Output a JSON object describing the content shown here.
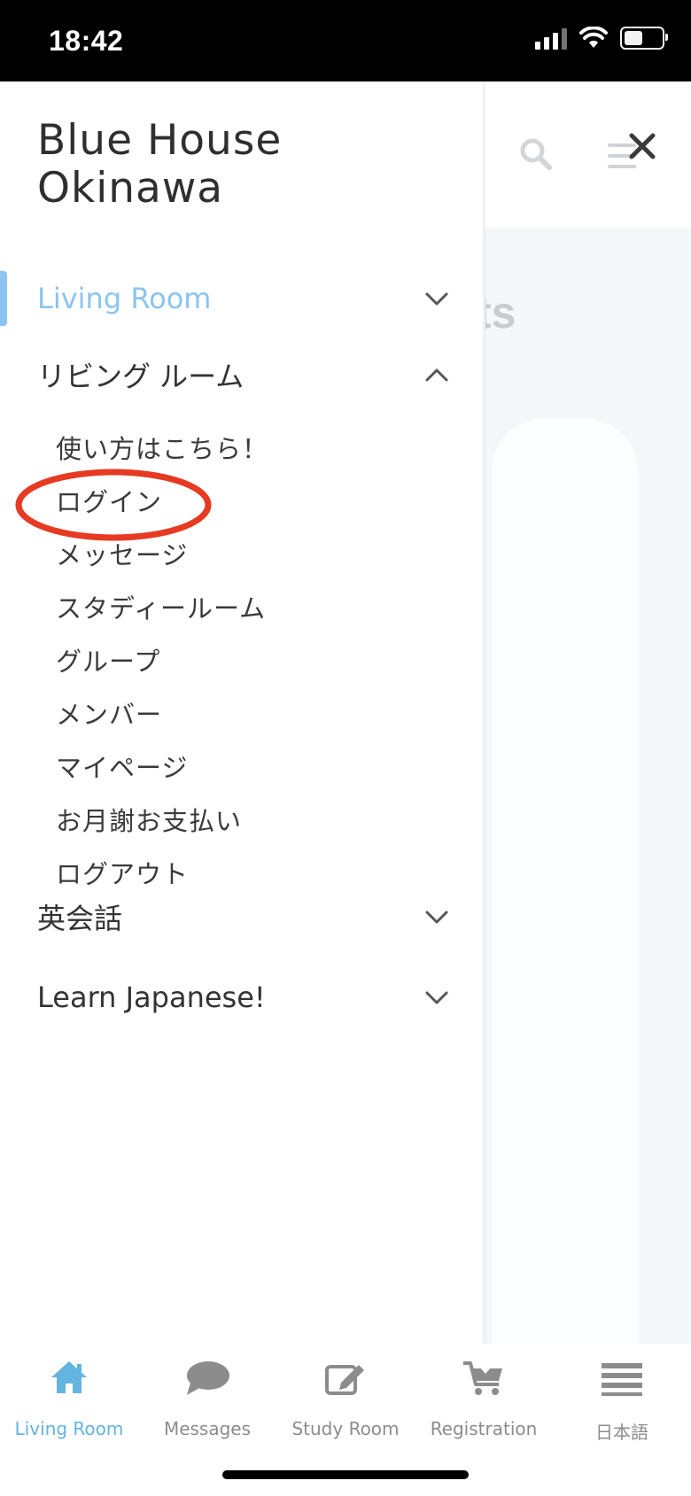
{
  "status_bar": {
    "time": "18:42"
  },
  "app": {
    "brand": "Blue House\nOkinawa"
  },
  "background": {
    "partial_heading": "ts"
  },
  "nav": {
    "sections": [
      {
        "label": "Living Room",
        "expanded": false,
        "active": true
      },
      {
        "label": "リビング ルーム",
        "expanded": true,
        "active": false
      },
      {
        "label": "英会話",
        "expanded": false,
        "active": false
      },
      {
        "label": "Learn Japanese!",
        "expanded": false,
        "active": false
      }
    ],
    "sub_items": [
      "使い方はこちら！",
      "ログイン",
      "メッセージ",
      "スタディールーム",
      "グループ",
      "メンバー",
      "マイページ",
      "お月謝お支払い",
      "ログアウト"
    ],
    "highlighted_item": "ログイン"
  },
  "tabbar": {
    "tabs": [
      {
        "label": "Living Room",
        "icon": "home-icon",
        "active": true
      },
      {
        "label": "Messages",
        "icon": "chat-bubble-icon",
        "active": false
      },
      {
        "label": "Study Room",
        "icon": "edit-icon",
        "active": false
      },
      {
        "label": "Registration",
        "icon": "cart-icon",
        "active": false
      },
      {
        "label": "日本語",
        "icon": "menu-lines-icon",
        "active": false
      }
    ]
  },
  "colors": {
    "accent": "#63b4de",
    "active_nav": "#8cc4ef",
    "highlight_circle": "#e63a22",
    "text": "#333333",
    "inactive_tab": "#8c8c8c"
  }
}
